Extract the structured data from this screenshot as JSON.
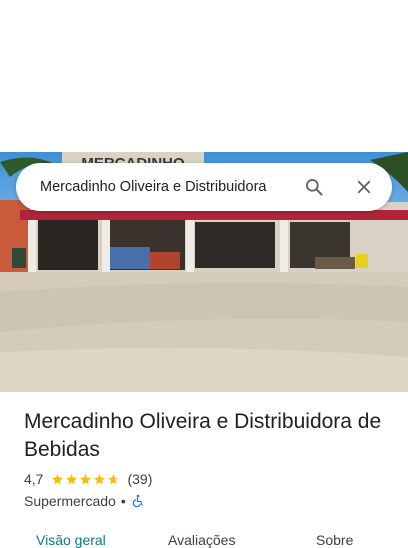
{
  "search": {
    "query": "Mercadinho Oliveira e Distribuidora"
  },
  "place": {
    "name": "Mercadinho Oliveira e Distribuidora de Bebidas",
    "rating": "4,7",
    "rating_value": 4.7,
    "review_count": "(39)",
    "category": "Supermercado",
    "separator": "•",
    "sign_text": "MERCADINHO"
  },
  "tabs": [
    {
      "label": "Visão geral",
      "active": true
    },
    {
      "label": "Avaliações",
      "active": false
    },
    {
      "label": "Sobre",
      "active": false
    }
  ],
  "colors": {
    "star": "#fbbc04",
    "accessibility": "#1a73e8",
    "active_tab": "#0b7a82"
  },
  "icons": [
    "search-icon",
    "close-icon",
    "star-icon",
    "wheelchair-icon"
  ]
}
